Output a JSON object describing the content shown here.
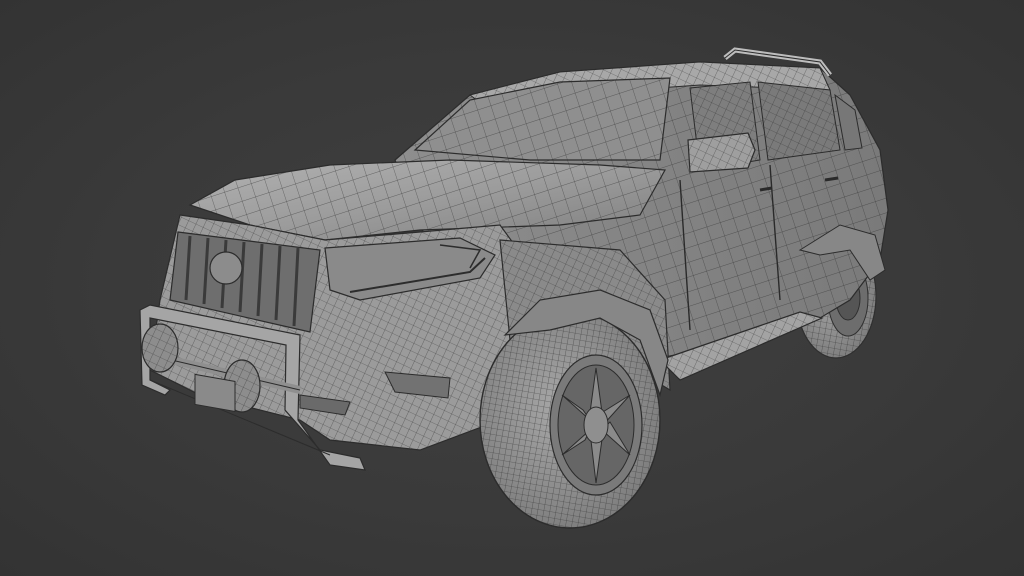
{
  "scene": {
    "subject": "suv-wireframe-render",
    "background_color": "#3a3a3a",
    "body_color": "#9a9a9a",
    "wire_color": "#2b2b2b"
  }
}
